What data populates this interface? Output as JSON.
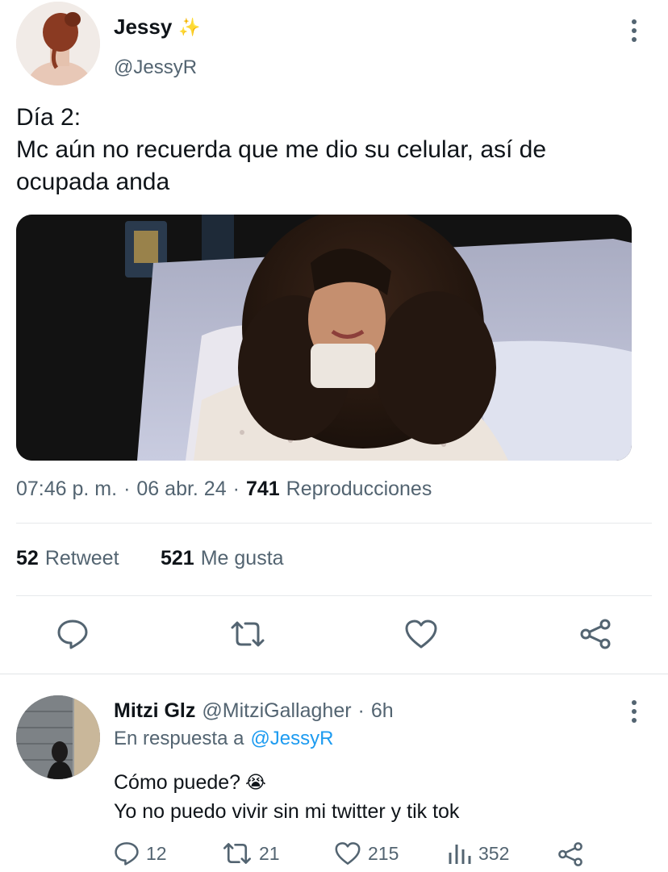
{
  "tweet": {
    "author": {
      "name": "Jessy",
      "badge_emoji": "✨",
      "handle": "@JessyR"
    },
    "text_lines": [
      "Día 2:",
      "Mc aún no recuerda que me dio su celular, así de",
      "ocupada anda"
    ],
    "meta": {
      "time": "07:46 p. m.",
      "sep": "·",
      "date": "06 abr. 24",
      "views_count": "741",
      "views_label": "Reproducciones"
    },
    "stats": {
      "retweets_count": "52",
      "retweets_label": "Retweet",
      "likes_count": "521",
      "likes_label": "Me gusta"
    },
    "actions": [
      "reply-icon",
      "retweet-icon",
      "heart-icon",
      "share-icon"
    ]
  },
  "reply": {
    "author": {
      "name": "Mitzi Glz",
      "handle": "@MitziGallagher",
      "sep": "·",
      "time": "6h"
    },
    "replying_to_prefix": "En respuesta a",
    "replying_to_handle": "@JessyR",
    "text_line1": "Cómo puede?",
    "emoji": "😭",
    "text_line2": "Yo no puedo vivir sin mi twitter y tik tok",
    "counts": {
      "replies": "12",
      "retweets": "21",
      "likes": "215",
      "views": "352"
    }
  },
  "colors": {
    "text": "#0f1419",
    "muted": "#536471",
    "link": "#1d9bf0",
    "divider": "#e6e9eb"
  }
}
